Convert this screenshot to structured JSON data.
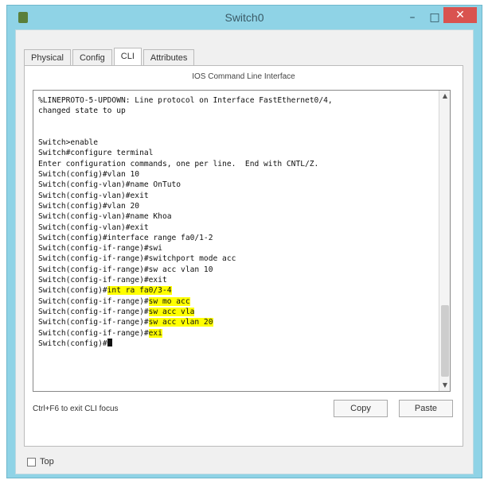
{
  "window": {
    "title": "Switch0",
    "controls": {
      "minimize": "–",
      "maximize": "□",
      "close": "✕"
    }
  },
  "tabs": [
    "Physical",
    "Config",
    "CLI",
    "Attributes"
  ],
  "active_tab": "CLI",
  "panel_title": "IOS Command Line Interface",
  "console": {
    "lines": [
      {
        "text": "%LINEPROTO-5-UPDOWN: Line protocol on Interface FastEthernet0/4,",
        "highlight": ""
      },
      {
        "text": "changed state to up",
        "highlight": ""
      },
      {
        "text": "",
        "highlight": ""
      },
      {
        "text": "",
        "highlight": ""
      },
      {
        "text": "Switch>enable",
        "highlight": ""
      },
      {
        "text": "Switch#configure terminal",
        "highlight": ""
      },
      {
        "text": "Enter configuration commands, one per line.  End with CNTL/Z.",
        "highlight": ""
      },
      {
        "text": "Switch(config)#vlan 10",
        "highlight": ""
      },
      {
        "text": "Switch(config-vlan)#name OnTuto",
        "highlight": ""
      },
      {
        "text": "Switch(config-vlan)#exit",
        "highlight": ""
      },
      {
        "text": "Switch(config)#vlan 20",
        "highlight": ""
      },
      {
        "text": "Switch(config-vlan)#name Khoa",
        "highlight": ""
      },
      {
        "text": "Switch(config-vlan)#exit",
        "highlight": ""
      },
      {
        "text": "Switch(config)#interface range fa0/1-2",
        "highlight": ""
      },
      {
        "text": "Switch(config-if-range)#swi",
        "highlight": ""
      },
      {
        "text": "Switch(config-if-range)#switchport mode acc",
        "highlight": ""
      },
      {
        "text": "Switch(config-if-range)#sw acc vlan 10",
        "highlight": ""
      },
      {
        "text": "Switch(config-if-range)#exit",
        "highlight": ""
      },
      {
        "text": "Switch(config)#",
        "highlight": "int ra fa0/3-4"
      },
      {
        "text": "Switch(config-if-range)#",
        "highlight": "sw mo acc"
      },
      {
        "text": "Switch(config-if-range)#",
        "highlight": "sw acc vla"
      },
      {
        "text": "Switch(config-if-range)#",
        "highlight": "sw acc vlan 20"
      },
      {
        "text": "Switch(config-if-range)#",
        "highlight": "exi"
      },
      {
        "text": "Switch(config)#",
        "highlight": ""
      }
    ]
  },
  "hint": "Ctrl+F6 to exit CLI focus",
  "buttons": {
    "copy": "Copy",
    "paste": "Paste"
  },
  "top_checkbox_label": "Top",
  "colors": {
    "titlebar": "#8fd3e6",
    "close": "#d9534f",
    "highlight": "#ffff00"
  }
}
